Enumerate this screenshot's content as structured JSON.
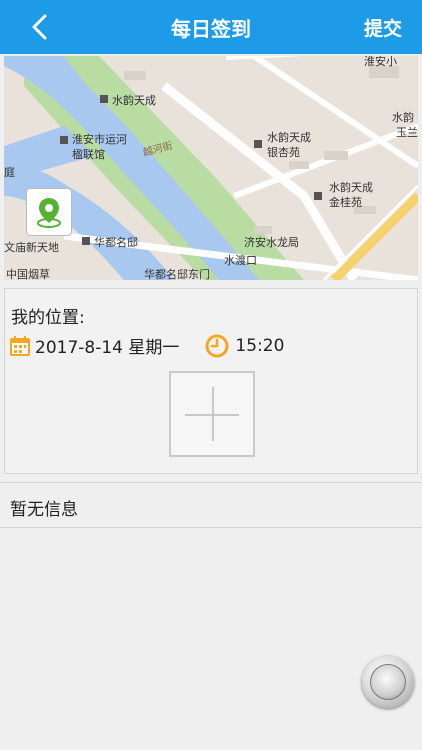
{
  "header": {
    "title": "每日签到",
    "submit_label": "提交"
  },
  "map": {
    "labels": {
      "shuiyun_tiancheng_1": "水韵天成",
      "huaian_yunhe": "淮安市运河",
      "jiulian_guan": "楹联馆",
      "yuehe_street": "越河街",
      "shuiyun_tiancheng_2": "水韵天成",
      "yinxing_yuan": "银杏苑",
      "shuiyun_tiancheng_3": "水韵天成",
      "jingui_yuan": "金桂苑",
      "huadu_mingdi": "华都名邸",
      "jian_shuilongju": "济安水龙局",
      "shuidu_kou": "水渡口",
      "miao_xintiandi": "文庙新天地",
      "zhongguo_yancao": "中国烟草",
      "huadu_mingdi_2": "华都名邸东门",
      "huaian_top": "淮安小",
      "shuiyun_right": "水韵",
      "yu_san": "玉兰",
      "ting": "庭"
    }
  },
  "location": {
    "label": "我的位置:",
    "date": "2017-8-14 星期一",
    "time": "15:20"
  },
  "info": {
    "text": "暂无信息"
  },
  "icons": {
    "back": "chevron-left-icon",
    "locate": "map-pin-icon",
    "calendar": "calendar-icon",
    "clock": "clock-icon",
    "add": "plus-icon"
  },
  "colors": {
    "header": "#1e9be6",
    "calendar": "#f5a623",
    "clock": "#f5a623",
    "pin": "#55b235"
  }
}
